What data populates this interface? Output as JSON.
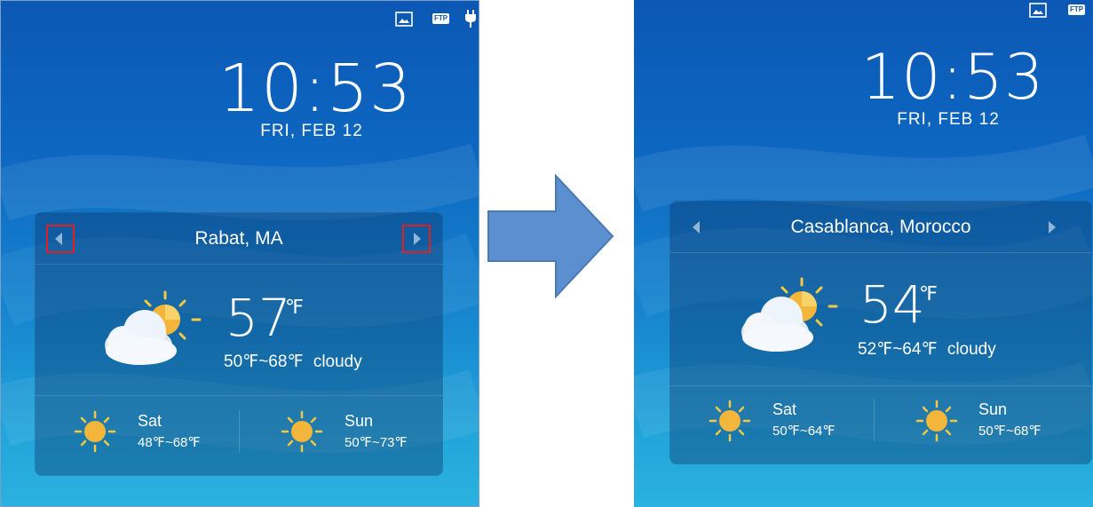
{
  "left_screen": {
    "status_icons": [
      "image-icon",
      "ftp-badge-icon",
      "plug-icon"
    ],
    "ftp_label": "FTP",
    "time": "10:53",
    "date": "FRI, FEB 12",
    "weather": {
      "city": "Rabat, MA",
      "temperature": "57",
      "unit": "℉",
      "range": "50℉~68℉",
      "condition": "cloudy",
      "forecast": [
        {
          "day": "Sat",
          "range": "48℉~68℉"
        },
        {
          "day": "Sun",
          "range": "50℉~73℉"
        }
      ]
    }
  },
  "right_screen": {
    "status_icons": [
      "image-icon",
      "ftp-badge-icon"
    ],
    "ftp_label": "FTP",
    "time": "10:53",
    "date": "FRI, FEB 12",
    "weather": {
      "city": "Casablanca, Morocco",
      "temperature": "54",
      "unit": "℉",
      "range": "52℉~64℉",
      "condition": "cloudy",
      "forecast": [
        {
          "day": "Sat",
          "range": "50℉~64℉"
        },
        {
          "day": "Sun",
          "range": "50℉~68℉"
        }
      ]
    }
  },
  "colors": {
    "highlight": "#e02020",
    "transition_arrow": "#5b8fcf",
    "transition_arrow_border": "#4a7ab3"
  }
}
